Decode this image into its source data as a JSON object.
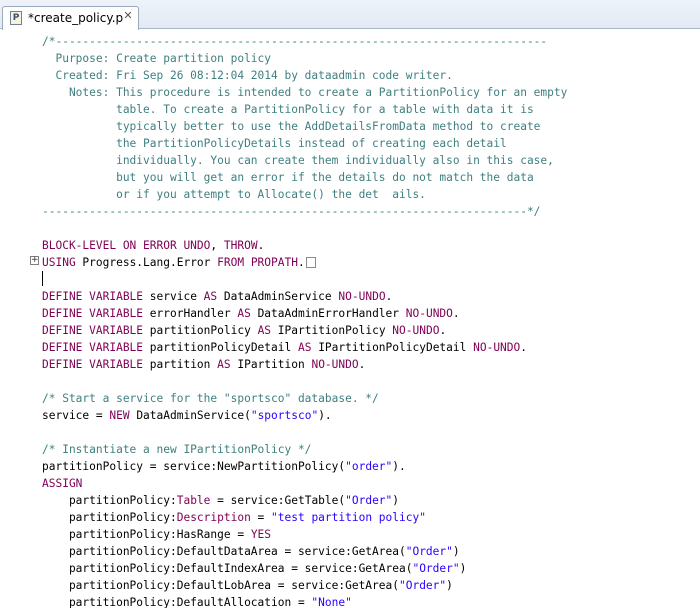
{
  "tab": {
    "title": "*create_policy.p",
    "icon": "P"
  },
  "code_lines": [
    [
      {
        "t": "comment",
        "v": "/*-------------------------------------------------------------------------"
      }
    ],
    [
      {
        "t": "comment",
        "v": "  Purpose: Create partition policy"
      }
    ],
    [
      {
        "t": "comment",
        "v": "  Created: Fri Sep 26 08:12:04 2014 by dataadmin code writer."
      }
    ],
    [
      {
        "t": "comment",
        "v": "    Notes: This procedure is intended to create a PartitionPolicy for an empty"
      }
    ],
    [
      {
        "t": "comment",
        "v": "           table. To create a PartitionPolicy for a table with data it is"
      }
    ],
    [
      {
        "t": "comment",
        "v": "           typically better to use the AddDetailsFromData method to create"
      }
    ],
    [
      {
        "t": "comment",
        "v": "           the PartitionPolicyDetails instead of creating each detail"
      }
    ],
    [
      {
        "t": "comment",
        "v": "           individually. You can create them individually also in this case,"
      }
    ],
    [
      {
        "t": "comment",
        "v": "           but you will get an error if the details do not match the data"
      }
    ],
    [
      {
        "t": "comment",
        "v": "           or if you attempt to Allocate() the det  ails."
      }
    ],
    [
      {
        "t": "comment",
        "v": "------------------------------------------------------------------------*/"
      }
    ],
    [],
    [
      {
        "t": "keyword",
        "v": "BLOCK-LEVEL ON ERROR UNDO"
      },
      {
        "t": "plain",
        "v": ", "
      },
      {
        "t": "keyword",
        "v": "THROW"
      },
      {
        "t": "plain",
        "v": "."
      }
    ],
    [
      {
        "t": "keyword",
        "v": "USING "
      },
      {
        "t": "plain",
        "v": "Progress.Lang.Error "
      },
      {
        "t": "keyword",
        "v": "FROM PROPATH"
      },
      {
        "t": "plain",
        "v": "."
      }
    ],
    [],
    [
      {
        "t": "keyword",
        "v": "DEFINE VARIABLE "
      },
      {
        "t": "plain",
        "v": "service "
      },
      {
        "t": "keyword",
        "v": "AS "
      },
      {
        "t": "plain",
        "v": "DataAdminService "
      },
      {
        "t": "keyword",
        "v": "NO-UNDO"
      },
      {
        "t": "plain",
        "v": "."
      }
    ],
    [
      {
        "t": "keyword",
        "v": "DEFINE VARIABLE "
      },
      {
        "t": "plain",
        "v": "errorHandler "
      },
      {
        "t": "keyword",
        "v": "AS "
      },
      {
        "t": "plain",
        "v": "DataAdminErrorHandler "
      },
      {
        "t": "keyword",
        "v": "NO-UNDO"
      },
      {
        "t": "plain",
        "v": "."
      }
    ],
    [
      {
        "t": "keyword",
        "v": "DEFINE VARIABLE "
      },
      {
        "t": "plain",
        "v": "partitionPolicy "
      },
      {
        "t": "keyword",
        "v": "AS "
      },
      {
        "t": "plain",
        "v": "IPartitionPolicy "
      },
      {
        "t": "keyword",
        "v": "NO-UNDO"
      },
      {
        "t": "plain",
        "v": "."
      }
    ],
    [
      {
        "t": "keyword",
        "v": "DEFINE VARIABLE "
      },
      {
        "t": "plain",
        "v": "partitionPolicyDetail "
      },
      {
        "t": "keyword",
        "v": "AS "
      },
      {
        "t": "plain",
        "v": "IPartitionPolicyDetail "
      },
      {
        "t": "keyword",
        "v": "NO-UNDO"
      },
      {
        "t": "plain",
        "v": "."
      }
    ],
    [
      {
        "t": "keyword",
        "v": "DEFINE VARIABLE "
      },
      {
        "t": "plain",
        "v": "partition "
      },
      {
        "t": "keyword",
        "v": "AS "
      },
      {
        "t": "plain",
        "v": "IPartition "
      },
      {
        "t": "keyword",
        "v": "NO-UNDO"
      },
      {
        "t": "plain",
        "v": "."
      }
    ],
    [],
    [
      {
        "t": "comment",
        "v": "/* Start a service for the \"sportsco\" database. */"
      }
    ],
    [
      {
        "t": "plain",
        "v": "service = "
      },
      {
        "t": "keyword",
        "v": "NEW "
      },
      {
        "t": "plain",
        "v": "DataAdminService("
      },
      {
        "t": "string",
        "v": "\"sportsco\""
      },
      {
        "t": "plain",
        "v": ")."
      }
    ],
    [],
    [
      {
        "t": "comment",
        "v": "/* Instantiate a new IPartitionPolicy */"
      }
    ],
    [
      {
        "t": "plain",
        "v": "partitionPolicy = service:NewPartitionPolicy("
      },
      {
        "t": "string",
        "v": "\"order\""
      },
      {
        "t": "plain",
        "v": ")."
      }
    ],
    [
      {
        "t": "keyword",
        "v": "ASSIGN"
      }
    ],
    [
      {
        "t": "plain",
        "v": "    partitionPolicy:"
      },
      {
        "t": "keyword",
        "v": "Table"
      },
      {
        "t": "plain",
        "v": " = service:GetTable("
      },
      {
        "t": "string",
        "v": "\"Order\""
      },
      {
        "t": "plain",
        "v": ")"
      }
    ],
    [
      {
        "t": "plain",
        "v": "    partitionPolicy:"
      },
      {
        "t": "keyword",
        "v": "Description"
      },
      {
        "t": "plain",
        "v": " = "
      },
      {
        "t": "string",
        "v": "\"test partition policy\""
      }
    ],
    [
      {
        "t": "plain",
        "v": "    partitionPolicy:HasRange = "
      },
      {
        "t": "keyword",
        "v": "YES"
      }
    ],
    [
      {
        "t": "plain",
        "v": "    partitionPolicy:DefaultDataArea = service:GetArea("
      },
      {
        "t": "string",
        "v": "\"Order\""
      },
      {
        "t": "plain",
        "v": ")"
      }
    ],
    [
      {
        "t": "plain",
        "v": "    partitionPolicy:DefaultIndexArea = service:GetArea("
      },
      {
        "t": "string",
        "v": "\"Order\""
      },
      {
        "t": "plain",
        "v": ")"
      }
    ],
    [
      {
        "t": "plain",
        "v": "    partitionPolicy:DefaultLobArea = service:GetArea("
      },
      {
        "t": "string",
        "v": "\"Order\""
      },
      {
        "t": "plain",
        "v": ")"
      }
    ],
    [
      {
        "t": "plain",
        "v": "    partitionPolicy:DefaultAllocation = "
      },
      {
        "t": "string",
        "v": "\"None\""
      }
    ]
  ]
}
